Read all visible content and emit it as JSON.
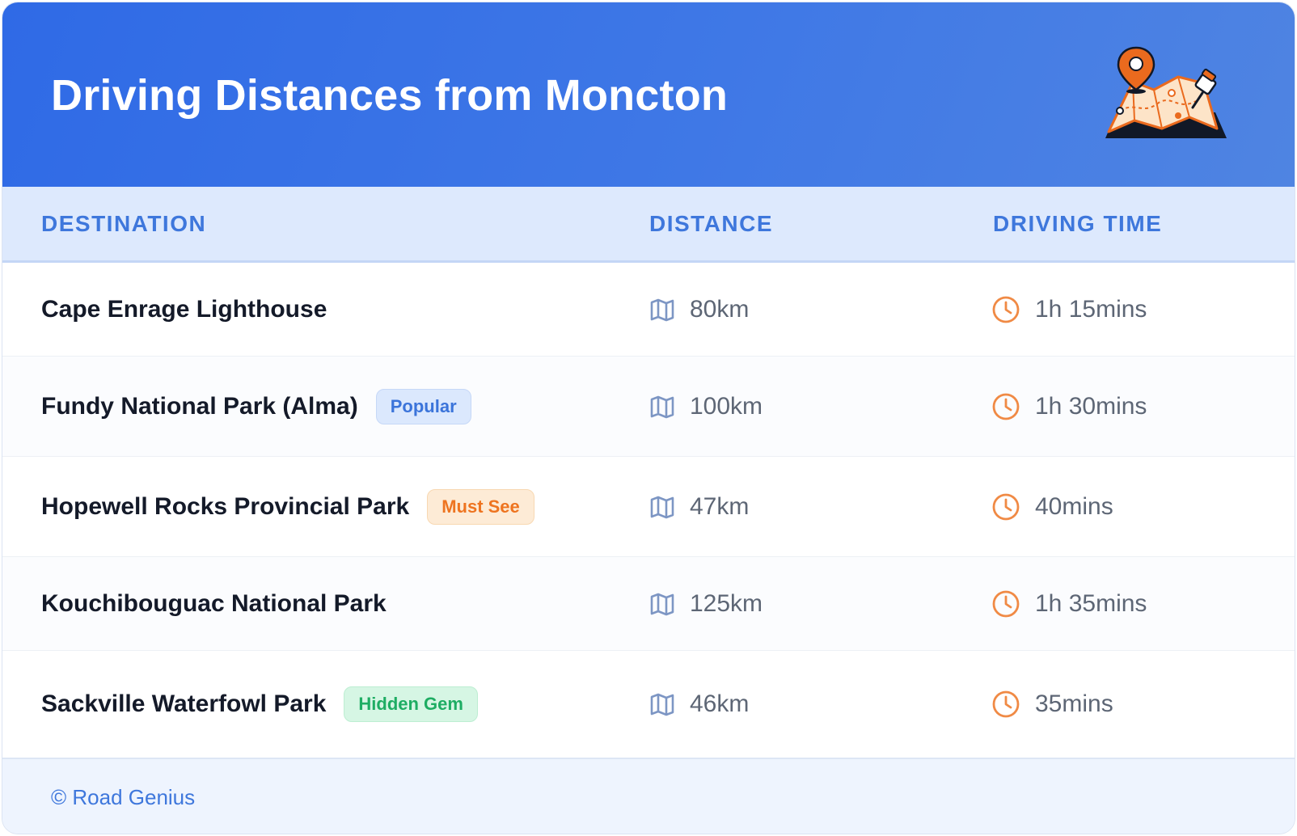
{
  "header": {
    "title": "Driving Distances from Moncton",
    "illustration_icon": "folded-map-with-pins-icon"
  },
  "table": {
    "columns": [
      "DESTINATION",
      "DISTANCE",
      "DRIVING TIME"
    ],
    "distance_icon": "map-icon",
    "time_icon": "clock-icon",
    "rows": [
      {
        "destination": "Cape Enrage Lighthouse",
        "badge": "",
        "badge_type": "",
        "distance": "80km",
        "time": "1h 15mins"
      },
      {
        "destination": "Fundy National Park (Alma)",
        "badge": "Popular",
        "badge_type": "popular",
        "distance": "100km",
        "time": "1h 30mins"
      },
      {
        "destination": "Hopewell Rocks Provincial Park",
        "badge": "Must See",
        "badge_type": "mustsee",
        "distance": "47km",
        "time": "40mins"
      },
      {
        "destination": "Kouchibouguac National Park",
        "badge": "",
        "badge_type": "",
        "distance": "125km",
        "time": "1h 35mins"
      },
      {
        "destination": "Sackville Waterfowl Park",
        "badge": "Hidden Gem",
        "badge_type": "hidden",
        "distance": "46km",
        "time": "35mins"
      }
    ]
  },
  "footer": {
    "copyright": "© Road Genius"
  },
  "colors": {
    "header_start": "#2f6ae6",
    "header_end": "#4f84e2",
    "accent_blue": "#3e77dc",
    "accent_orange": "#ee7420",
    "accent_green": "#1ead63"
  }
}
